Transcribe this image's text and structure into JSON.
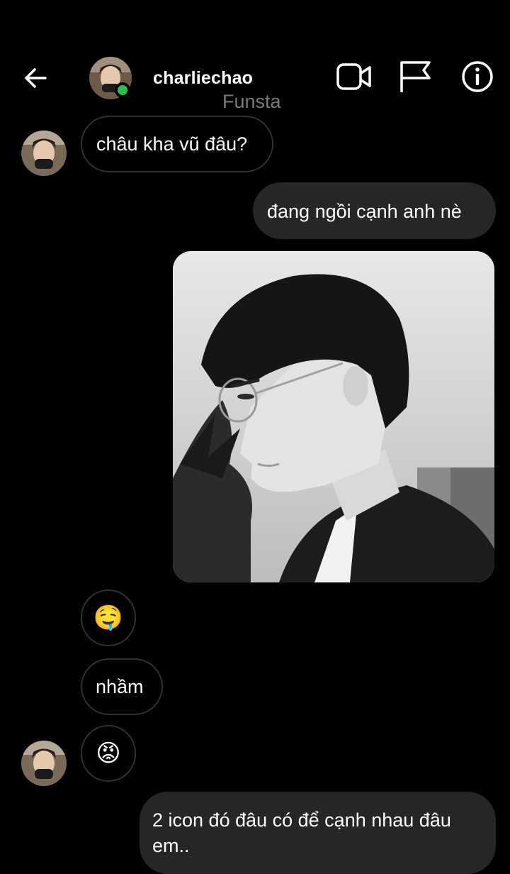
{
  "header": {
    "username": "charliechao",
    "subtitle": "Funsta",
    "back_icon": "arrow-left-icon",
    "video_icon": "video-call-icon",
    "flag_icon": "flag-icon",
    "info_icon": "info-icon",
    "online_color": "#27c24c"
  },
  "messages": [
    {
      "side": "incoming",
      "text": "châu kha vũ đâu?"
    },
    {
      "side": "outgoing",
      "text": "đang ngồi cạnh anh nè"
    },
    {
      "side": "outgoing",
      "type": "photo"
    },
    {
      "side": "incoming",
      "text": "🤤"
    },
    {
      "side": "incoming",
      "text": "nhầm"
    },
    {
      "side": "incoming",
      "text": "😡"
    },
    {
      "side": "outgoing",
      "text": "2 icon đó đâu có để cạnh nhau đâu em.."
    }
  ],
  "colors": {
    "background": "#000000",
    "outgoing_bubble": "#262626",
    "incoming_border": "#303030",
    "subtitle": "#7a7a7a"
  }
}
